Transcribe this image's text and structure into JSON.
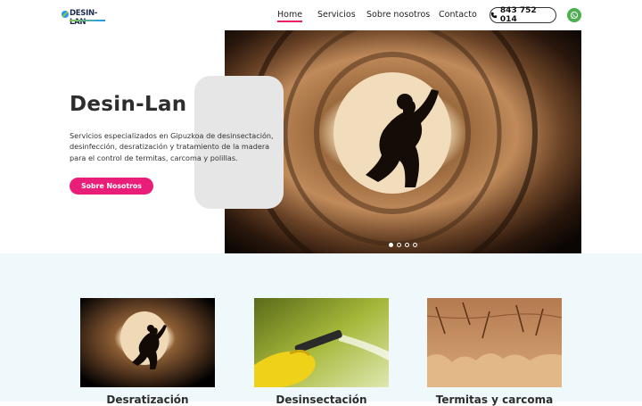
{
  "brand": {
    "logo_text": "DESIN-LAN"
  },
  "nav": {
    "items": [
      {
        "label": "Home"
      },
      {
        "label": "Servicios"
      },
      {
        "label": "Sobre nosotros"
      },
      {
        "label": "Contacto"
      }
    ],
    "phone": "843 752 014",
    "active_item": "Home",
    "accent_color": "#e91e63"
  },
  "hero": {
    "title": "Desin-Lan",
    "description": "Servicios especializados en Gipuzkoa de desinsectación, desinfección, desratización y tratamiento de la madera para el control de termitas, carcoma y polillas.",
    "cta_label": "Sobre Nosotros",
    "cta_color": "#e91e78",
    "slides_total": 4,
    "active_slide": 1
  },
  "services": [
    {
      "title": "Desratización",
      "image": "worker-in-pipe"
    },
    {
      "title": "Desinsectación",
      "image": "gloved-hand-spraying"
    },
    {
      "title": "Termitas y carcoma",
      "image": "damaged-wood"
    }
  ]
}
